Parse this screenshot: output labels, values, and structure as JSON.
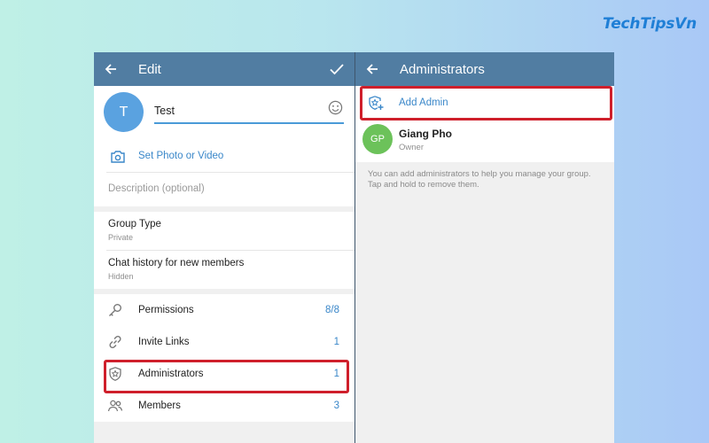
{
  "brand": {
    "logo_text": "TechTipsVn"
  },
  "edit_panel": {
    "title": "Edit",
    "avatar_letter": "T",
    "group_name": "Test",
    "set_photo_label": "Set Photo or Video",
    "description_placeholder": "Description (optional)",
    "group_type": {
      "title": "Group Type",
      "value": "Private"
    },
    "chat_history": {
      "title": "Chat history for new members",
      "value": "Hidden"
    },
    "settings": [
      {
        "label": "Permissions",
        "value": "8/8",
        "icon": "key-icon"
      },
      {
        "label": "Invite Links",
        "value": "1",
        "icon": "link-icon"
      },
      {
        "label": "Administrators",
        "value": "1",
        "icon": "shield-star-icon"
      },
      {
        "label": "Members",
        "value": "3",
        "icon": "members-icon"
      }
    ]
  },
  "admins_panel": {
    "title": "Administrators",
    "add_admin_label": "Add Admin",
    "admins": [
      {
        "initials": "GP",
        "name": "Giang Pho",
        "role": "Owner"
      }
    ],
    "hint": "You can add administrators to help you manage your group. Tap and hold to remove them."
  },
  "colors": {
    "header": "#517da2",
    "accent": "#3a87c9",
    "highlight": "#cf1f2b",
    "avatar_test": "#5aa2e0",
    "avatar_gp": "#6cc25a"
  }
}
